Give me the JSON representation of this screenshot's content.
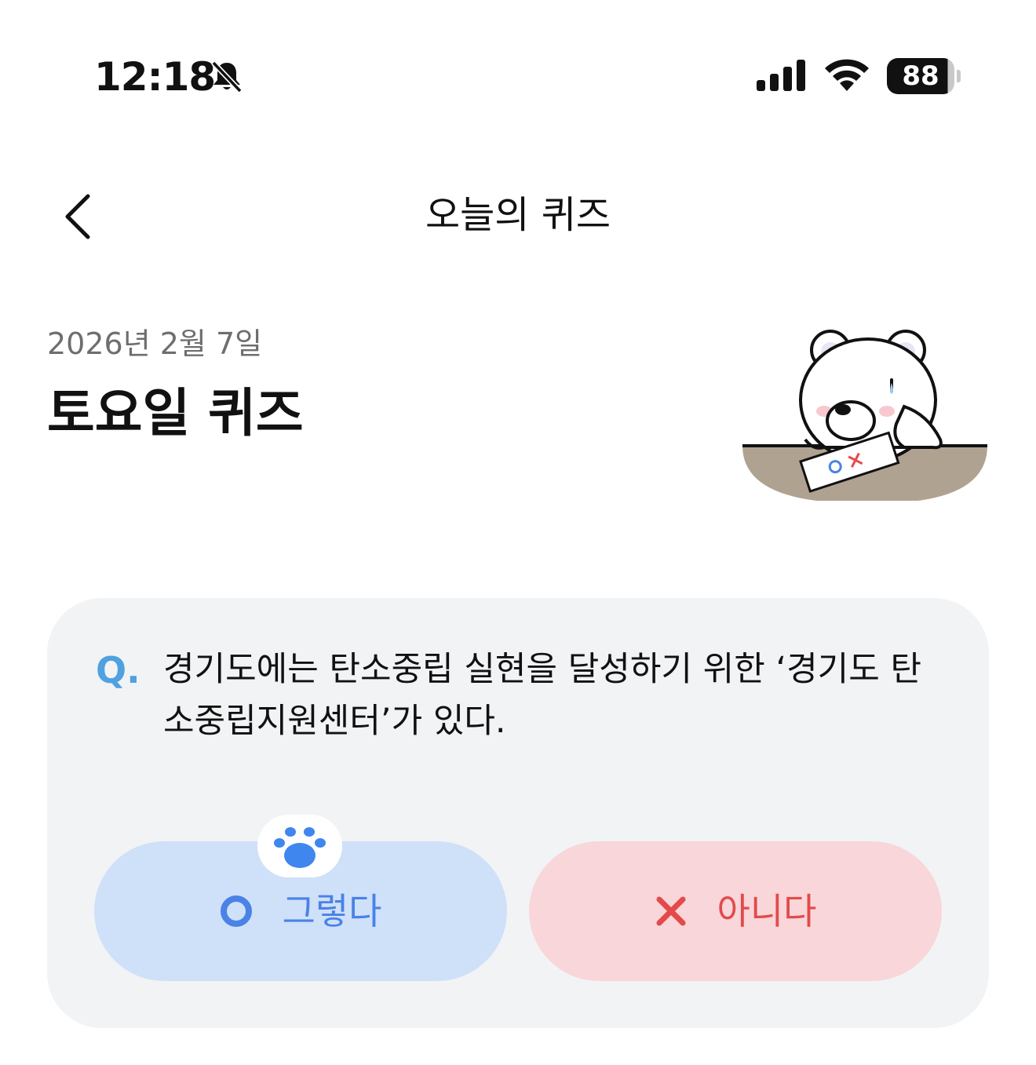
{
  "status_bar": {
    "time": "12:18",
    "silent_icon": "bell-slash-icon",
    "signal_icon": "cellular-signal-icon",
    "wifi_icon": "wifi-icon",
    "battery_level": "88"
  },
  "nav": {
    "back_icon": "chevron-left-icon",
    "title": "오늘의 퀴즈"
  },
  "header": {
    "date": "2026년 2월 7일",
    "title": "토요일 퀴즈",
    "illustration": "bear-with-ox-paper-illustration"
  },
  "quiz": {
    "q_label": "Q.",
    "question": "경기도에는 탄소중립 실현을 달성하기 위한 ‘경기도 탄소중립지원센터’가 있다.",
    "options": [
      {
        "label": "그렇다",
        "icon": "circle-o-icon",
        "color": "#4a82e6",
        "selected_hint": "paw-icon"
      },
      {
        "label": "아니다",
        "icon": "x-icon",
        "color": "#e34a4a"
      }
    ]
  },
  "colors": {
    "card_bg": "#f2f3f5",
    "yes_bg": "#cfe0f9",
    "no_bg": "#f8d6da",
    "q_mark": "#4fa1e0"
  }
}
